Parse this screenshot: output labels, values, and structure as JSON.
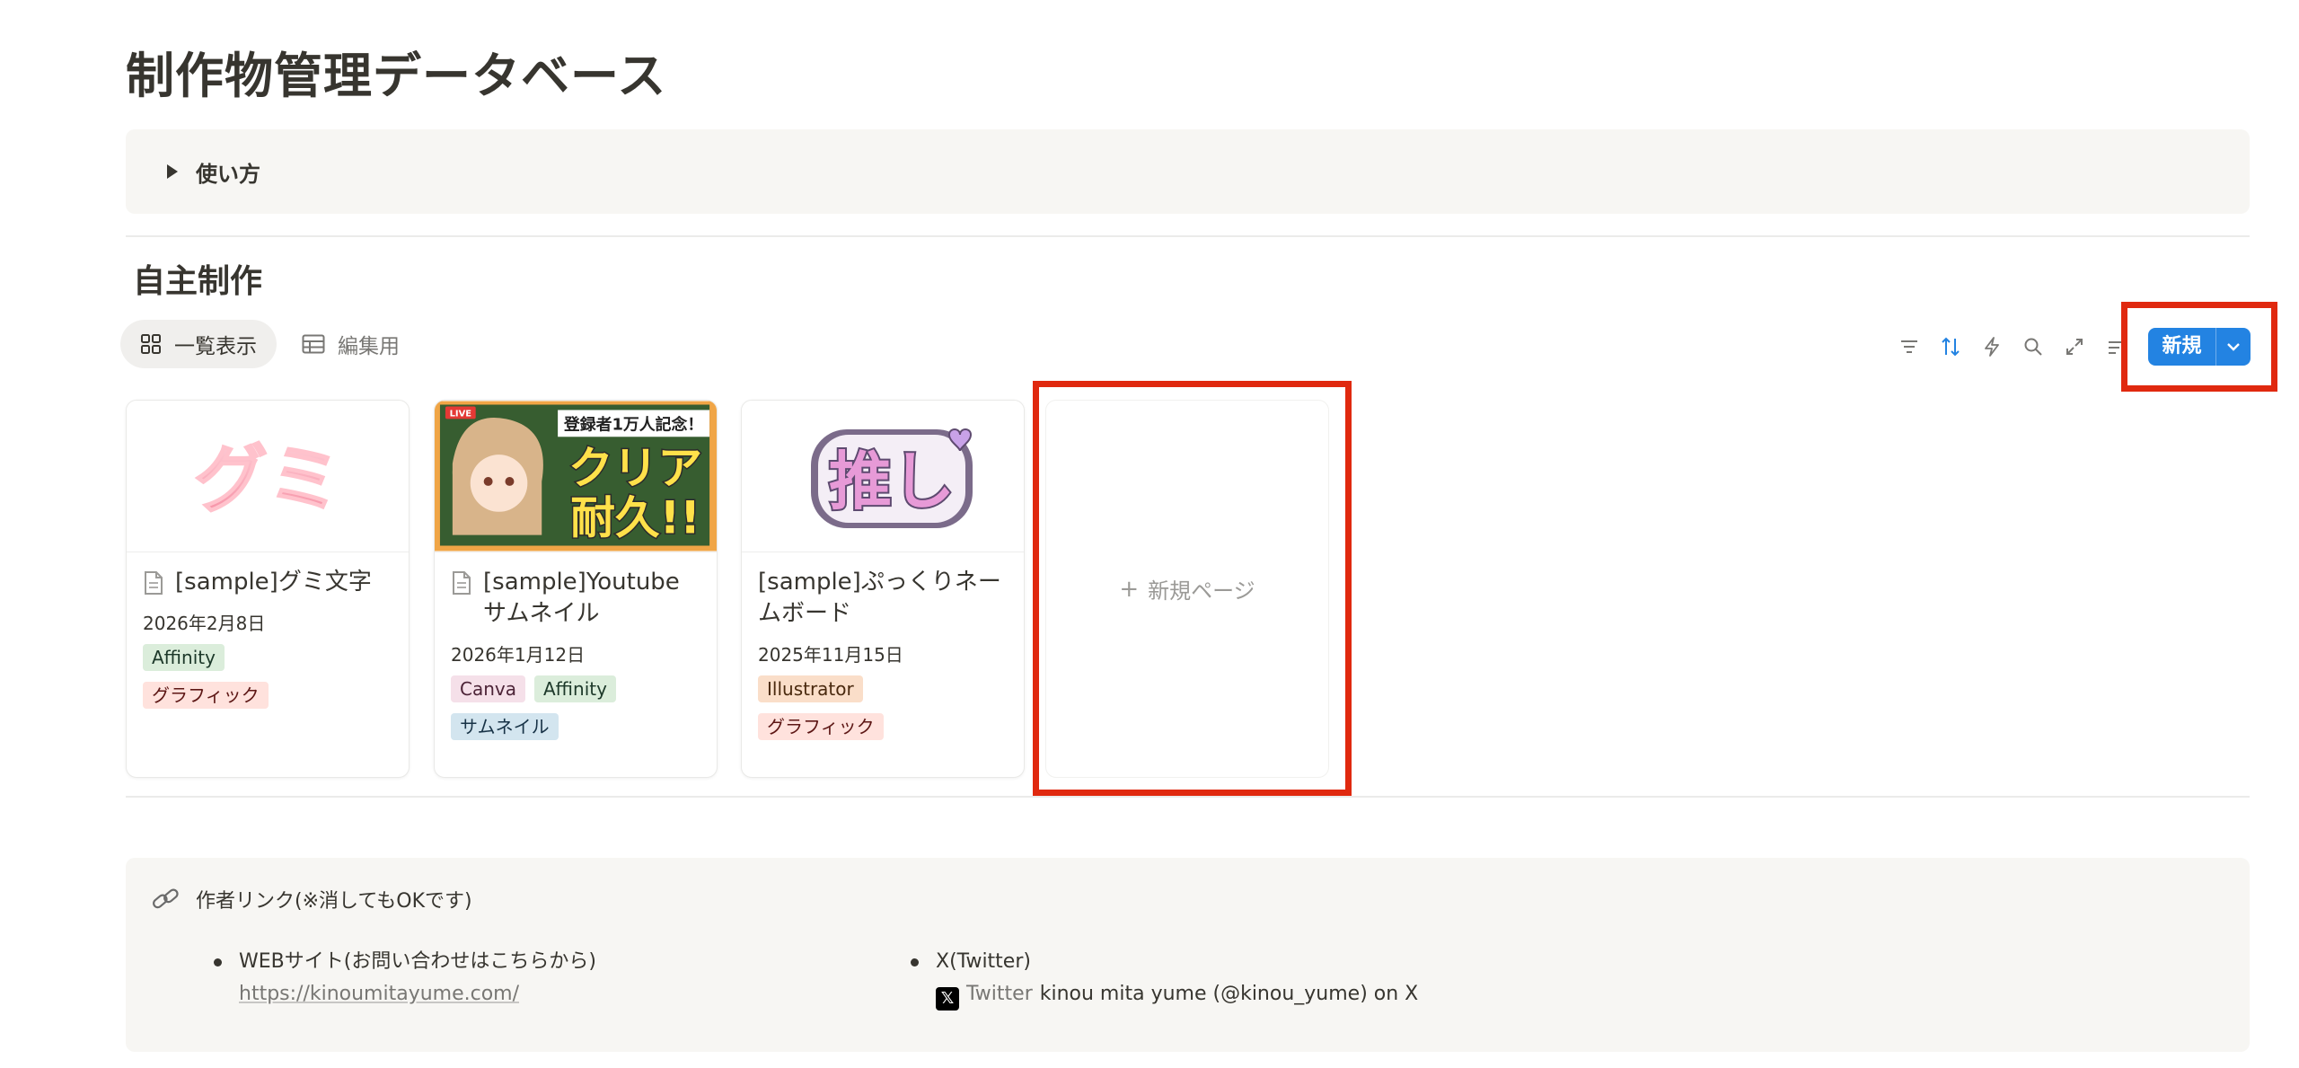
{
  "page": {
    "title": "制作物管理データベース"
  },
  "toggle": {
    "label": "使い方"
  },
  "section": {
    "title": "自主制作"
  },
  "views": [
    {
      "label": "一覧表示",
      "icon": "gallery-icon",
      "active": true
    },
    {
      "label": "編集用",
      "icon": "table-icon",
      "active": false
    }
  ],
  "toolbar": {
    "icons": [
      "filter-icon",
      "sort-icon",
      "automation-icon",
      "search-icon",
      "expand-icon",
      "more-icon"
    ],
    "new_label": "新規",
    "accent": "#2383e2"
  },
  "cards": [
    {
      "cover_text": "グミ",
      "title": "[sample]グミ文字",
      "show_doc_icon": true,
      "date": "2026年2月8日",
      "tags": [
        {
          "label": "Affinity",
          "color": "green"
        },
        {
          "label": "グラフィック",
          "color": "red"
        }
      ]
    },
    {
      "cover_banner": "登録者1万人記念！",
      "cover_badge": "LIVE",
      "cover_line1": "クリア",
      "cover_line2": "耐久!!",
      "title": "[sample]Youtubeサムネイル",
      "show_doc_icon": true,
      "date": "2026年1月12日",
      "tags": [
        {
          "label": "Canva",
          "color": "pink"
        },
        {
          "label": "Affinity",
          "color": "green"
        },
        {
          "label": "サムネイル",
          "color": "blue"
        }
      ]
    },
    {
      "cover_text": "推し",
      "title": "[sample]ぷっくりネームボード",
      "show_doc_icon": false,
      "date": "2025年11月15日",
      "tags": [
        {
          "label": "Illustrator",
          "color": "orange"
        },
        {
          "label": "グラフィック",
          "color": "red"
        }
      ]
    }
  ],
  "new_page": {
    "label": "新規ページ"
  },
  "callout": {
    "icon": "link-icon",
    "title": "作者リンク(※消してもOKです)",
    "links": [
      {
        "label": "WEBサイト(お問い合わせはこちらから)",
        "url": "https://kinoumitayume.com/"
      },
      {
        "label": "X(Twitter)",
        "mention_source": "Twitter",
        "mention_text": "kinou mita yume (@kinou_yume) on X"
      }
    ]
  },
  "highlight_color": "#e0290f"
}
